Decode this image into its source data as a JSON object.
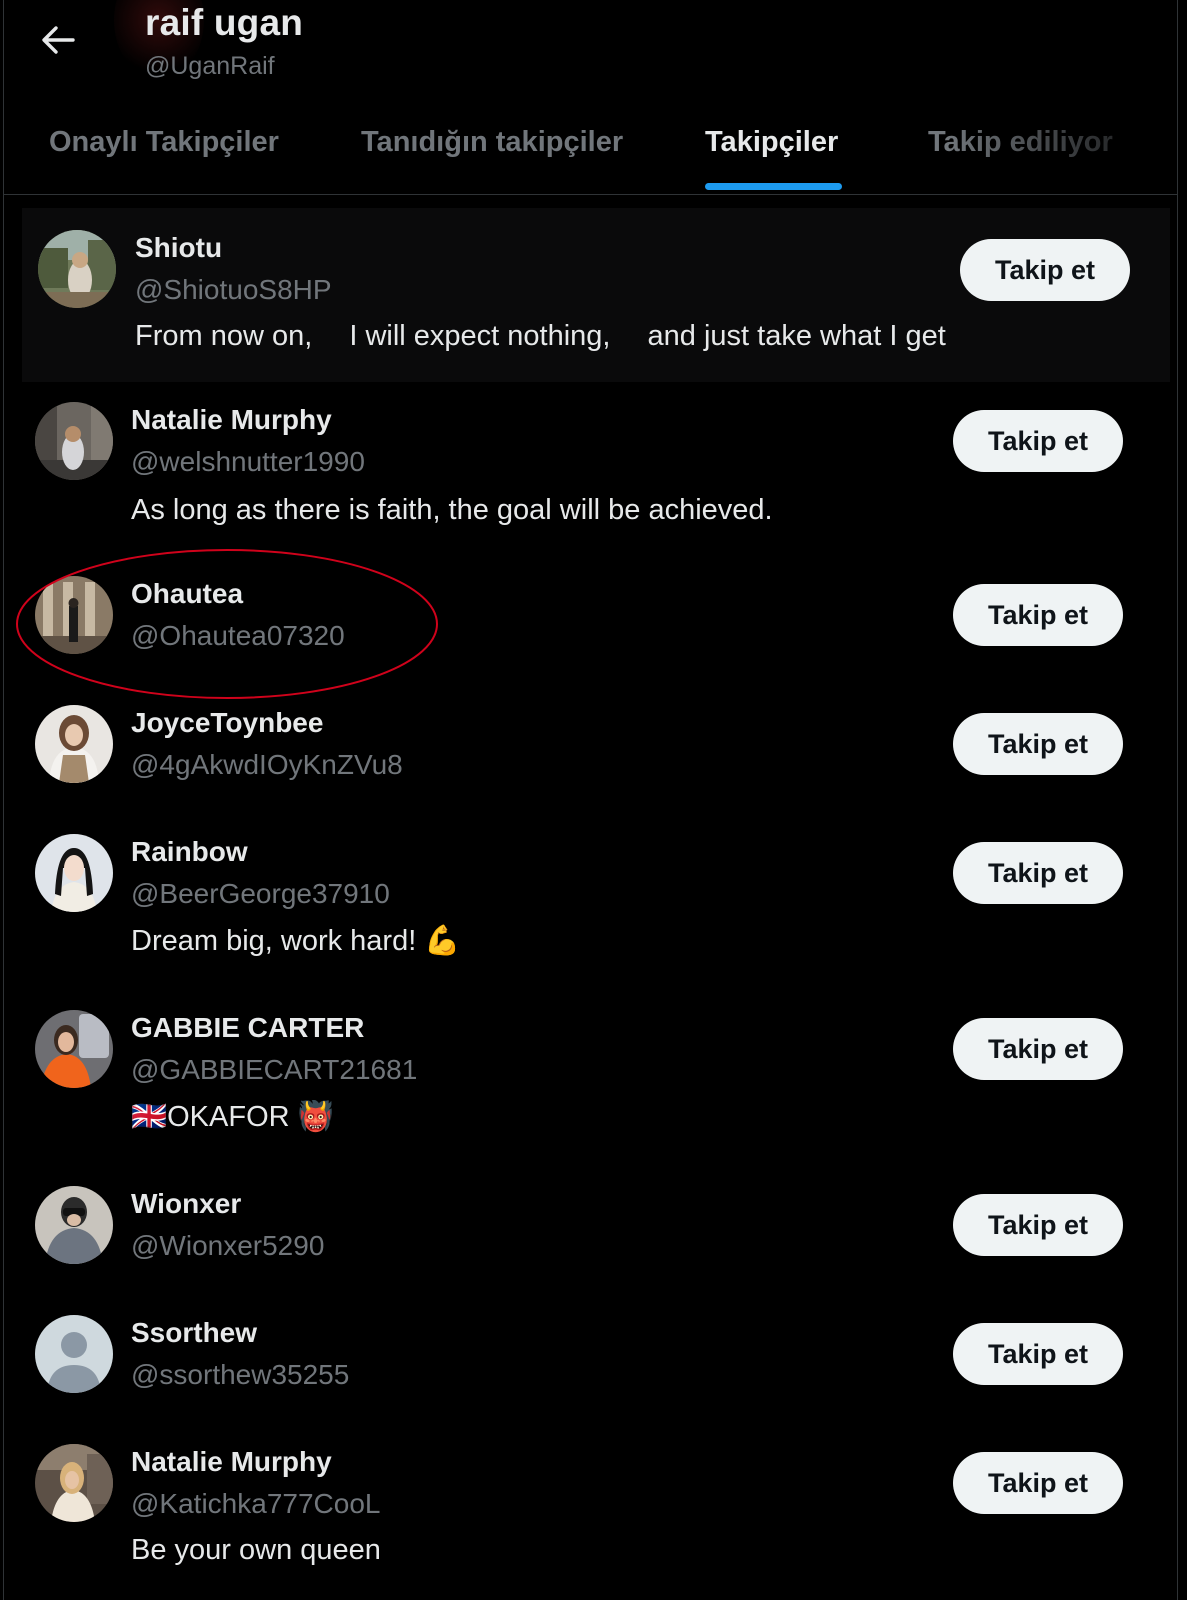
{
  "header": {
    "title": "raif ugan",
    "handle": "@UganRaif",
    "back_icon": "arrow-left-icon"
  },
  "tabs": [
    {
      "label": "Onaylı Takipçiler",
      "active": false
    },
    {
      "label": "Tanıdığın takipçiler",
      "active": false
    },
    {
      "label": "Takipçiler",
      "active": true
    },
    {
      "label": "Takip ediliyor",
      "active": false
    }
  ],
  "colors": {
    "accent": "#1d9bf0",
    "background": "#000000",
    "annotation": "#d0021b"
  },
  "follow_label": "Takip et",
  "users": [
    {
      "name": "Shiotu",
      "handle": "@ShiotuoS8HP",
      "bio": "From now on,  I will expect nothing,  and just take what I get"
    },
    {
      "name": "Natalie Murphy",
      "handle": "@welshnutter1990",
      "bio": "As long as there is faith, the goal will be achieved."
    },
    {
      "name": "Ohautea",
      "handle": "@Ohautea07320",
      "bio": ""
    },
    {
      "name": "JoyceToynbee",
      "handle": "@4gAkwdIOyKnZVu8",
      "bio": ""
    },
    {
      "name": "Rainbow",
      "handle": "@BeerGeorge37910",
      "bio": "Dream big, work hard! 💪"
    },
    {
      "name": "GABBIE CARTER",
      "handle": "@GABBIECART21681",
      "bio": "🇬🇧OKAFOR 👹"
    },
    {
      "name": "Wionxer",
      "handle": "@Wionxer5290",
      "bio": ""
    },
    {
      "name": "Ssorthew",
      "handle": "@ssorthew35255",
      "bio": ""
    },
    {
      "name": "Natalie Murphy",
      "handle": "@Katichka777CooL",
      "bio": "Be your own queen"
    }
  ]
}
